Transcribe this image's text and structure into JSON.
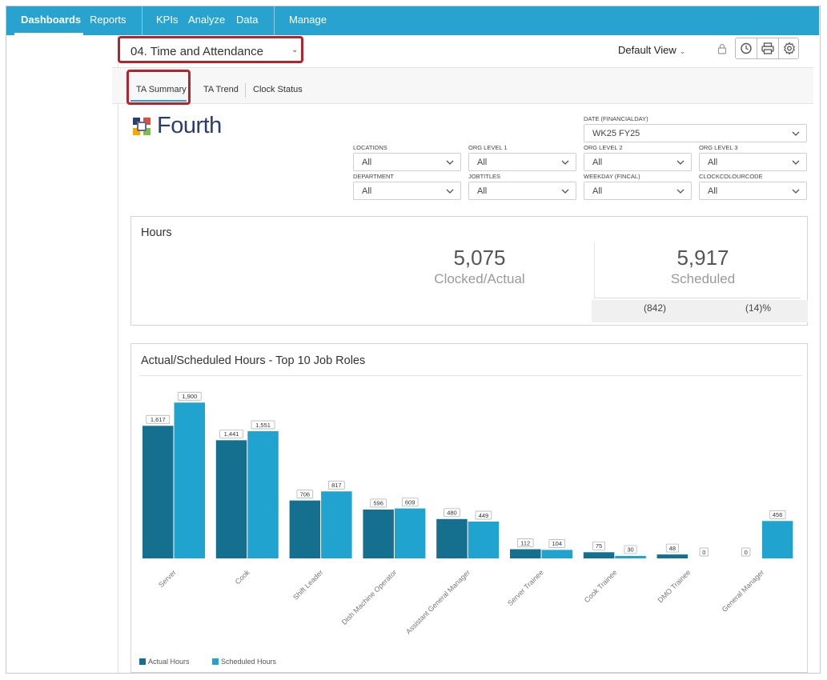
{
  "nav": {
    "items": [
      "Dashboards",
      "Reports",
      "KPIs",
      "Analyze",
      "Data",
      "Manage"
    ]
  },
  "dashboard": {
    "title": "04. Time and Attendance",
    "view": "Default View"
  },
  "tabs": [
    "TA Summary",
    "TA Trend",
    "Clock Status"
  ],
  "logo": {
    "text": "Fourth"
  },
  "filters": [
    {
      "label": "DATE (FINANCIALDAY)",
      "value": "WK25 FY25"
    },
    {
      "label": "LOCATIONS",
      "value": "All"
    },
    {
      "label": "ORG LEVEL 1",
      "value": "All"
    },
    {
      "label": "ORG LEVEL 2",
      "value": "All"
    },
    {
      "label": "ORG LEVEL 3",
      "value": "All"
    },
    {
      "label": "DEPARTMENT",
      "value": "All"
    },
    {
      "label": "JOBTITLES",
      "value": "All"
    },
    {
      "label": "WEEKDAY (FINCAL)",
      "value": "All"
    },
    {
      "label": "CLOCKCOLOURCODE",
      "value": "All"
    }
  ],
  "hours": {
    "title": "Hours",
    "clocked_value": "5,075",
    "clocked_label": "Clocked/Actual",
    "scheduled_value": "5,917",
    "scheduled_label": "Scheduled",
    "variance_value": "(842)",
    "variance_pct": "(14)%"
  },
  "colors": {
    "accent": "#28a3cf",
    "actual": "#15708f",
    "scheduled": "#21a3cf",
    "highlight": "#b5232e"
  },
  "chart_data": {
    "type": "bar",
    "title": "Actual/Scheduled Hours - Top 10 Job Roles",
    "categories": [
      "Server",
      "Cook",
      "Shift Leader",
      "Dish Machine Operator",
      "Assistant General Manager",
      "Server Trainee",
      "Cook Trainee",
      "DMO Trainee",
      "General Manager"
    ],
    "series": [
      {
        "name": "Actual Hours",
        "values": [
          1617,
          1441,
          706,
          596,
          480,
          112,
          75,
          48,
          0
        ]
      },
      {
        "name": "Scheduled Hours",
        "values": [
          1900,
          1551,
          817,
          609,
          449,
          104,
          30,
          0,
          456
        ]
      }
    ],
    "labels": {
      "actual": [
        "1,617",
        "1,441",
        "706",
        "596",
        "480",
        "112",
        "75",
        "48",
        "0"
      ],
      "scheduled": [
        "1,900",
        "1,551",
        "817",
        "609",
        "449",
        "104",
        "30",
        "0",
        "456"
      ]
    },
    "ylim": [
      0,
      2000
    ],
    "legend": "bottom-left"
  }
}
